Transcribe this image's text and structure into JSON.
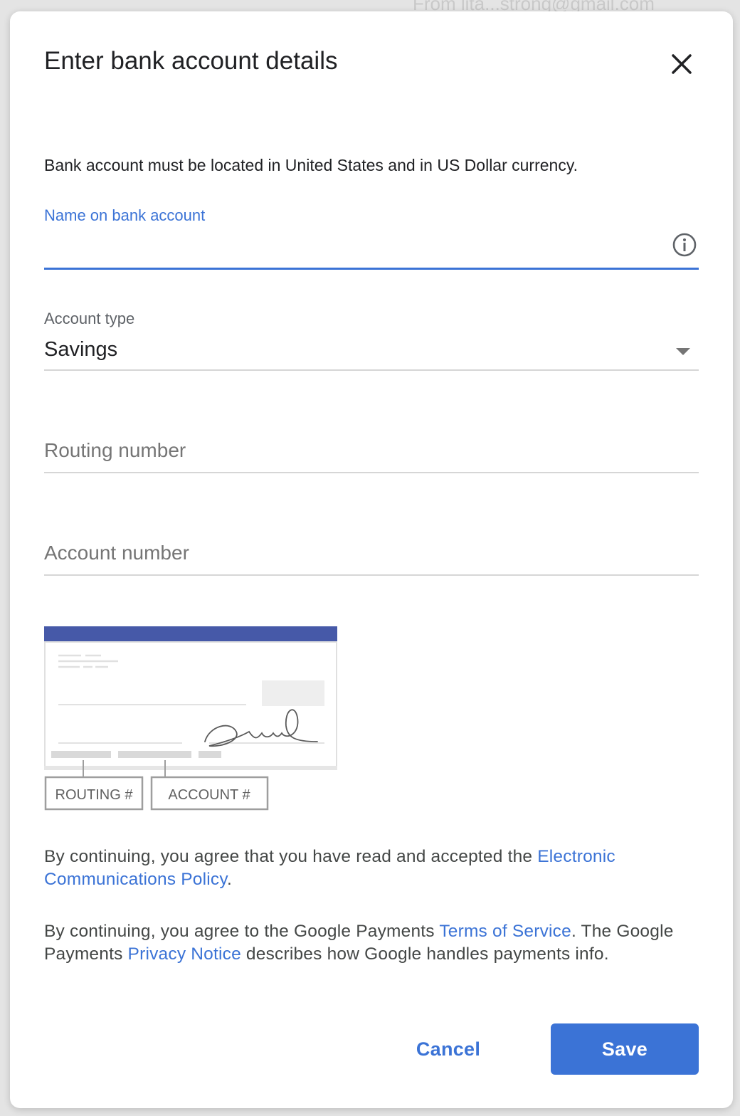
{
  "background": {
    "partial_text": "From lita...strong@gmail.com"
  },
  "dialog": {
    "title": "Enter bank account details",
    "close_icon": "close-icon",
    "notice": "Bank account must be located in United States and in US Dollar currency.",
    "name_field": {
      "label": "Name on bank account",
      "value": "",
      "info_icon": "info-icon"
    },
    "account_type": {
      "label": "Account type",
      "selected": "Savings"
    },
    "routing_field": {
      "placeholder": "Routing number",
      "value": ""
    },
    "account_field": {
      "placeholder": "Account number",
      "value": ""
    },
    "check_illustration": {
      "routing_label": "ROUTING #",
      "account_label": "ACCOUNT #"
    },
    "legal1": {
      "text": "By continuing, you agree that you have read and accepted the ",
      "link": "Electronic Communications Policy",
      "end": "."
    },
    "legal2": {
      "text1": "By continuing, you agree to the Google Payments ",
      "link1": "Terms of Service",
      "text2": ". The Google Payments ",
      "link2": "Privacy Notice",
      "text3": " describes how Google handles payments info."
    },
    "buttons": {
      "cancel": "Cancel",
      "save": "Save"
    }
  },
  "colors": {
    "accent": "#3b73d6",
    "check_header": "#4659a8",
    "text_primary": "#202124",
    "text_secondary": "#757575"
  }
}
